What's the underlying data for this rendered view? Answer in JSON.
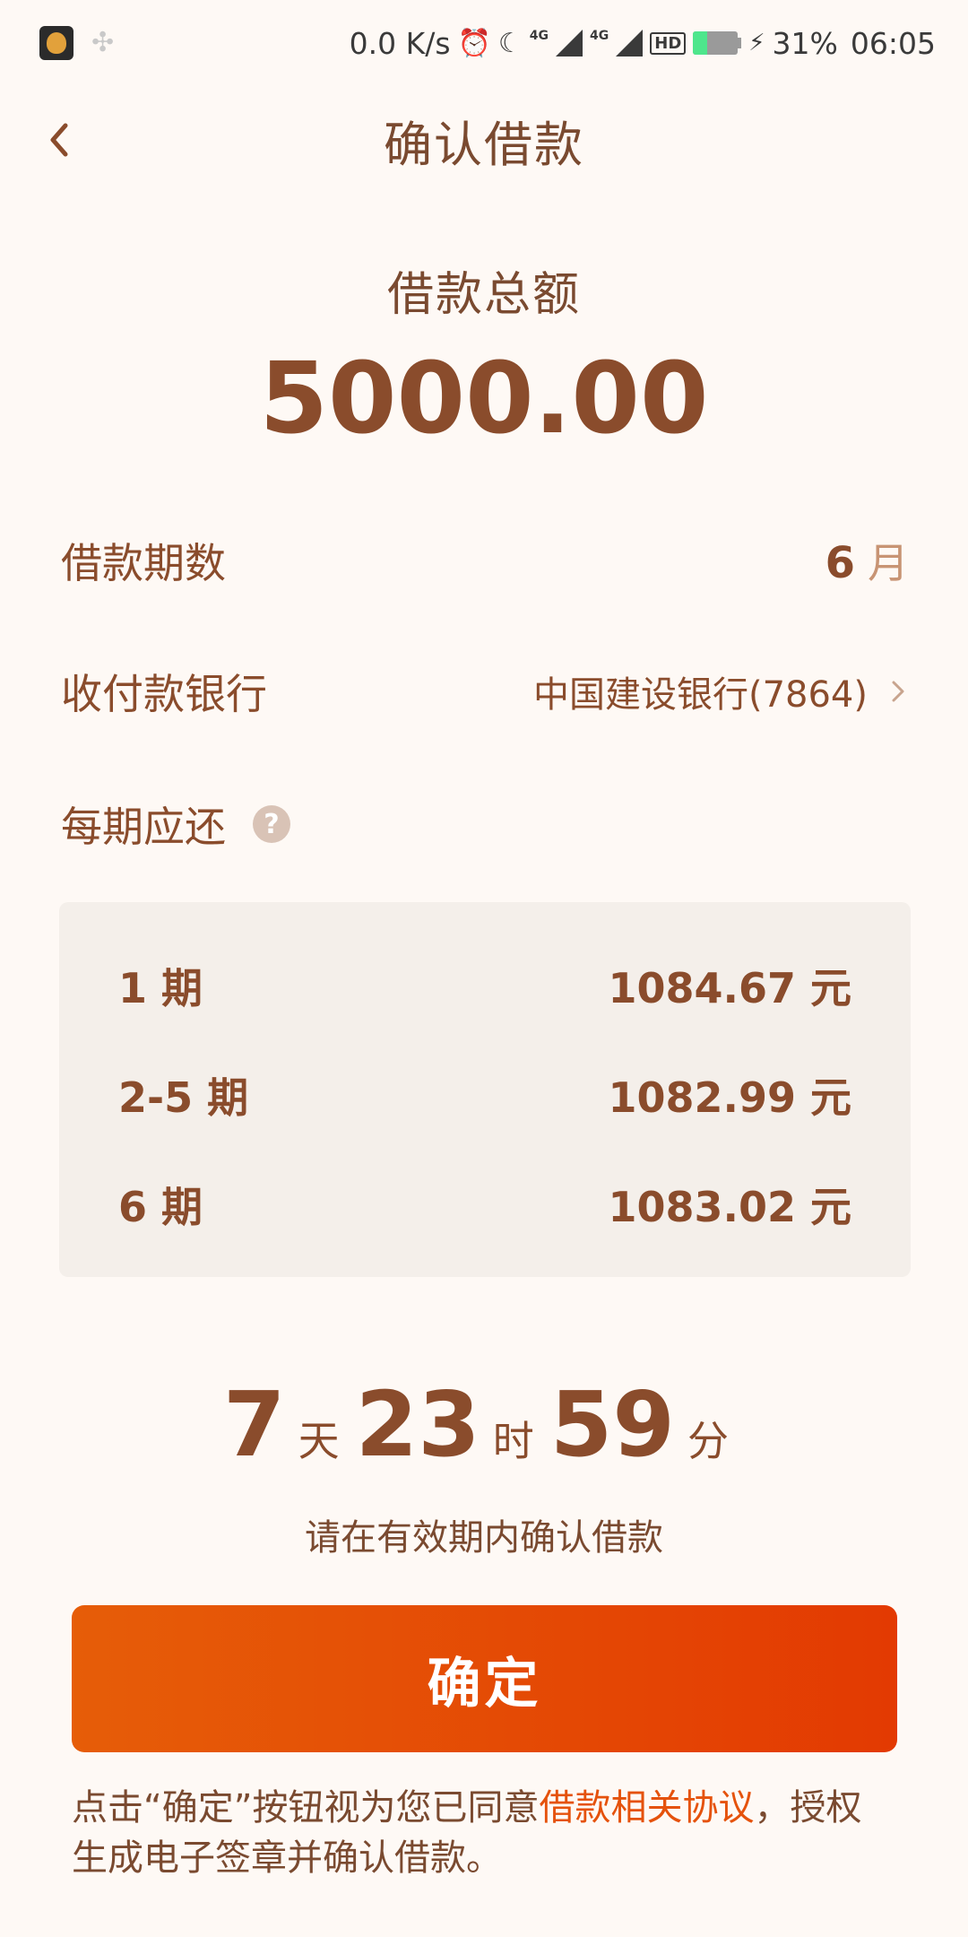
{
  "status_bar": {
    "network_speed": "0.0 K/s",
    "tag_4g_1": "4G",
    "tag_4g_2": "4G",
    "hd": "HD",
    "battery_percent": "31%",
    "battery_level": 0.31,
    "time": "06:05"
  },
  "header": {
    "title": "确认借款"
  },
  "loan": {
    "amount_label": "借款总额",
    "amount": "5000.00",
    "periods_label": "借款期数",
    "periods_value": "6",
    "periods_unit": "月",
    "bank_label": "收付款银行",
    "bank_value": "中国建设银行(7864)",
    "per_period_label": "每期应还"
  },
  "schedule": [
    {
      "period": "1 期",
      "amount": "1084.67 元"
    },
    {
      "period": "2-5 期",
      "amount": "1082.99 元"
    },
    {
      "period": "6 期",
      "amount": "1083.02 元"
    }
  ],
  "countdown": {
    "days": "7",
    "days_unit": "天",
    "hours": "23",
    "hours_unit": "时",
    "minutes": "59",
    "minutes_unit": "分",
    "hint": "请在有效期内确认借款"
  },
  "confirm_button": "确定",
  "agreement": {
    "prefix": "点击“确定”按钮视为您已同意",
    "link": "借款相关协议",
    "suffix": "，授权生成电子签章并确认借款。"
  },
  "colors": {
    "accent": "#e5520c",
    "text_brown": "#8a4c2c",
    "background": "#fef9f5"
  }
}
